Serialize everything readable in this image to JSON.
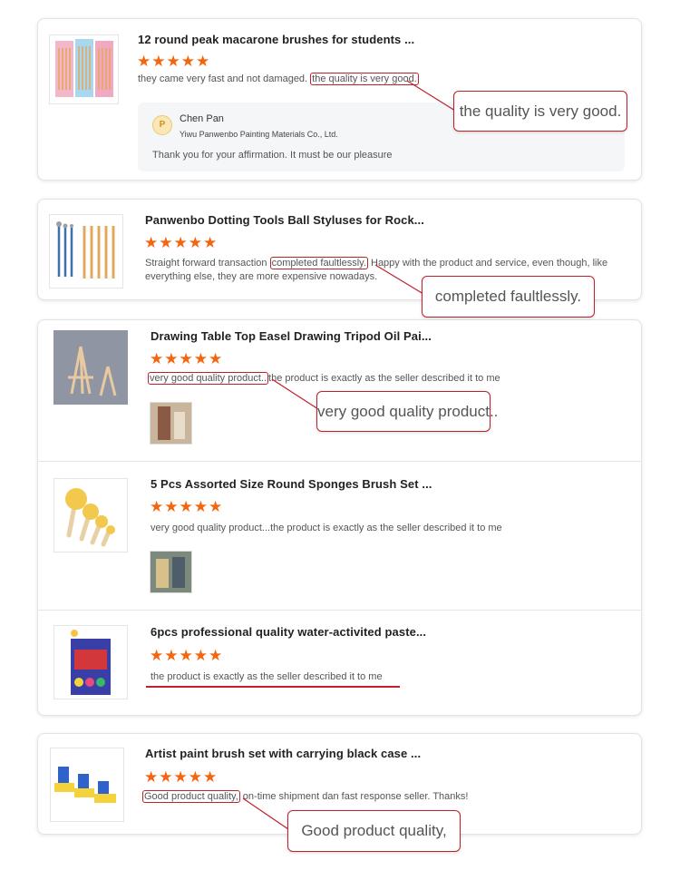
{
  "reviews": [
    {
      "title": "12 round peak macarone brushes for students ...",
      "stars": "★★★★★",
      "text_before": "they came very fast and not damaged. ",
      "text_highlight": "the quality is very good.",
      "text_after": "",
      "callout": "the quality is very good.",
      "reply": {
        "name": "Chen Pan",
        "company": "Yiwu Panwenbo Painting Materials Co., Ltd.",
        "text": "Thank you for your affirmation. It must be our pleasure"
      }
    },
    {
      "title": "Panwenbo Dotting Tools Ball Styluses for Rock...",
      "stars": "★★★★★",
      "text_before": "Straight forward transaction ",
      "text_highlight": "completed faultlessly.",
      "text_after": " Happy with the product and service, even though, like everything else, they are more expensive nowadays.",
      "callout": "completed faultlessly."
    },
    {
      "title": "Drawing Table Top Easel Drawing Tripod Oil Pai...",
      "stars": "★★★★★",
      "text_before": "",
      "text_highlight": "very good quality product..",
      "text_after": "the product is exactly as the seller described it to me",
      "callout": "very good quality product.."
    },
    {
      "title": "5 Pcs Assorted Size Round Sponges Brush Set ...",
      "stars": "★★★★★",
      "text_full": "very good quality product...the product is exactly as the seller described it to me"
    },
    {
      "title": "6pcs professional quality water-activited paste...",
      "stars": "★★★★★",
      "text_full": "the product is exactly as the seller described it to me"
    },
    {
      "title": "Artist paint brush set with carrying black case ...",
      "stars": "★★★★★",
      "text_before": "",
      "text_highlight": "Good product quality,",
      "text_after": " on-time shipment dan fast response seller. Thanks!",
      "callout": "Good product quality,"
    }
  ],
  "colors": {
    "star": "#f5640f",
    "annotation": "#c0202a"
  },
  "icons": {
    "star": "star-icon",
    "logo": "seller-logo-icon"
  }
}
